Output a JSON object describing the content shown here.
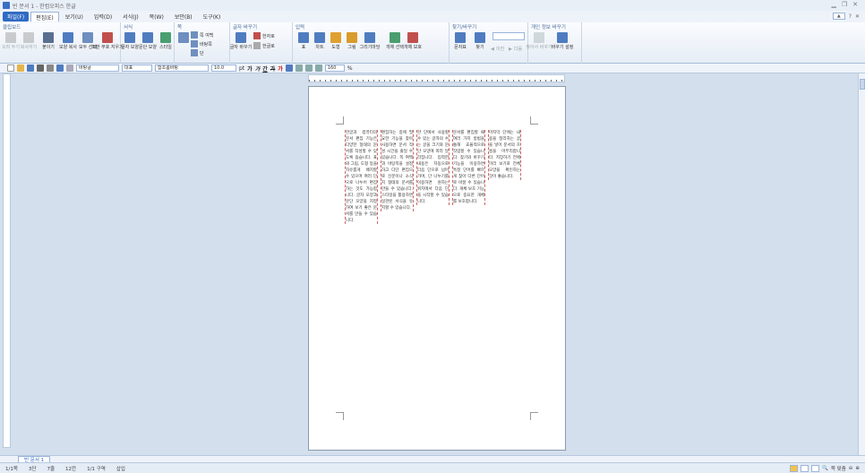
{
  "window": {
    "title": "빈 문서 1 - 한컴오피스 한글"
  },
  "menu": {
    "file": "파일(F)",
    "items": [
      "편집(E)",
      "보기(U)",
      "입력(D)",
      "서식(J)",
      "쪽(W)",
      "보안(B)",
      "도구(K)"
    ],
    "help": "?"
  },
  "ribbon": {
    "groups": [
      "클립보드",
      "서식",
      "쪽",
      "글자 바꾸기",
      "입력",
      "찾기/바꾸기",
      "개인 정보 바꾸기"
    ],
    "clipboard": {
      "cut": "오려 두기",
      "copy": "복사하기",
      "paste": "붙이기",
      "shape_copy": "모양 복사",
      "select_all": "모두 선택",
      "erase": "조판 부호 지우기"
    },
    "format": {
      "char_shape": "글자 모양",
      "para_shape": "문단 모양",
      "style": "스타일"
    },
    "page": {
      "page_area": "쪽 여백",
      "page_border": "바탕쪽",
      "column": "단"
    },
    "char_change": {
      "change": "글자 바꾸기",
      "hanja": "한자로",
      "hangul": "한글로"
    },
    "input": {
      "table": "표",
      "chart": "차트",
      "shape": "도형",
      "picture": "그림",
      "drawing": "그리기마당",
      "object_select": "개체 선택",
      "object_protect": "개체 보호"
    },
    "find": {
      "symbol": "문자표",
      "find": "찾기",
      "change": "바꾸기",
      "prev": "이전",
      "next": "다음"
    },
    "privacy": {
      "find": "찾아서 바꾸기",
      "setting": "바꾸기 설정"
    }
  },
  "toolbar": {
    "style_value": "바탕글",
    "lang_value": "대표",
    "font_value": "함초롬바탕",
    "size_value": "10.0",
    "size_unit": "pt",
    "bold": "가",
    "italic": "가",
    "underline": "간",
    "strike": "가",
    "color": "가",
    "spacing_value": "160",
    "spacing_unit": "%"
  },
  "document": {
    "columns": [
      "한글과 컴퓨터의 문서 편집 기능은 다양한 형태의 문서를 작성할 수 있도록 돕습니다. 표와 그림, 도형 등을 자유롭게 배치할 수 있으며 여러 단으로 나누어 편집하는 것도 가능합니다. 글자 모양과 문단 모양을 지정하여 보기 좋은 문서를 만들 수 있습니다.",
      "편집하는 중에 필요한 기능을 찾아 사용하면 문서 작성 시간을 줄일 수 있습니다. 쪽 여백과 바탕쪽을 설정하고 다단 편집으로 신문이나 소식지 형태의 문서를 만들 수 있습니다. 스타일을 활용하면 일관된 서식을 유지할 수 있습니다.",
      "한 단에서 사용할 수 있는 글자의 수는 글꼴 크기와 문단 모양에 따라 달라집니다. 입력한 내용은 자동으로 다음 단으로 넘어가며, 단 나누기를 이용하면 원하는 위치에서 다음 단을 시작할 수 있습니다.",
      "문서를 편집할 때 여러 가지 방법을 통해 효율적으로 작업할 수 있습니다. 찾기와 바꾸기 기능을 이용하면 특정 단어를 빠르게 찾아 다른 단어로 바꿀 수 있습니다. 개체 보호 기능으로 중요한 개체를 보호합니다.",
      "마지막 단에는 내용을 정리하는 글을 넣어 문서의 흐름을 마무리합니다. 저장하기 전에 미리 보기로 전체 모양을 확인하는 것이 좋습니다."
    ]
  },
  "tabs": [
    "빈 문서 1"
  ],
  "status": {
    "page": "1/1쪽",
    "column": "3단",
    "line": "7줄",
    "char": "12칸",
    "section": "1/1 구역",
    "mode": "삽입",
    "zoom": "쪽 맞춤"
  }
}
